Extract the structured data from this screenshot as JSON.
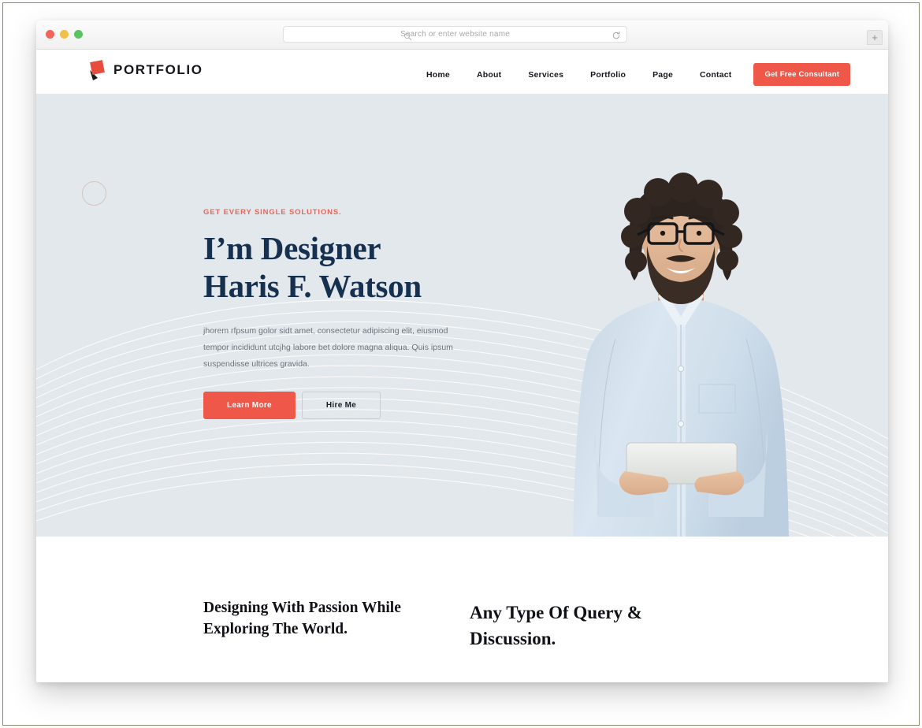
{
  "browser": {
    "traffic_lights": [
      "close",
      "minimize",
      "maximize"
    ],
    "address_bar": {
      "placeholder": "Search or enter website name",
      "value": "",
      "search_icon": "search-icon",
      "reload_icon": "reload-icon"
    },
    "new_tab_label": "+"
  },
  "site": {
    "header": {
      "brand": "PORTFOLIO",
      "nav": [
        {
          "label": "Home"
        },
        {
          "label": "About"
        },
        {
          "label": "Services"
        },
        {
          "label": "Portfolio"
        },
        {
          "label": "Page"
        },
        {
          "label": "Contact"
        }
      ],
      "cta_label": "Get Free Consultant"
    },
    "hero": {
      "eyebrow": "GET EVERY SINGLE SOLUTIONS.",
      "headline_line1": "I’m Designer",
      "headline_line2": "Haris F. Watson",
      "paragraph": "jhorem rfpsum golor sidt amet, consectetur adipiscing elit, eiusmod tempor incididunt utcjhg labore bet dolore magna aliqua. Quis ipsum suspendisse ultrices gravida.",
      "primary_button": "Learn More",
      "secondary_button": "Hire Me",
      "photo_alt": "Smiling bearded man with curly hair and glasses wearing a light blue shirt holding a white tablet"
    },
    "bottom": {
      "left_heading": "Designing With Passion While Exploring The World.",
      "right_heading": "Any Type Of Query & Discussion."
    }
  },
  "colors": {
    "accent_red": "#ef5748",
    "eyebrow_red": "#e2695d",
    "headline_navy": "#16304f",
    "hero_background": "#e3e8ec",
    "body_text": "#6d737c",
    "heading_black": "#111217",
    "frame_border": "#8a8a72"
  }
}
